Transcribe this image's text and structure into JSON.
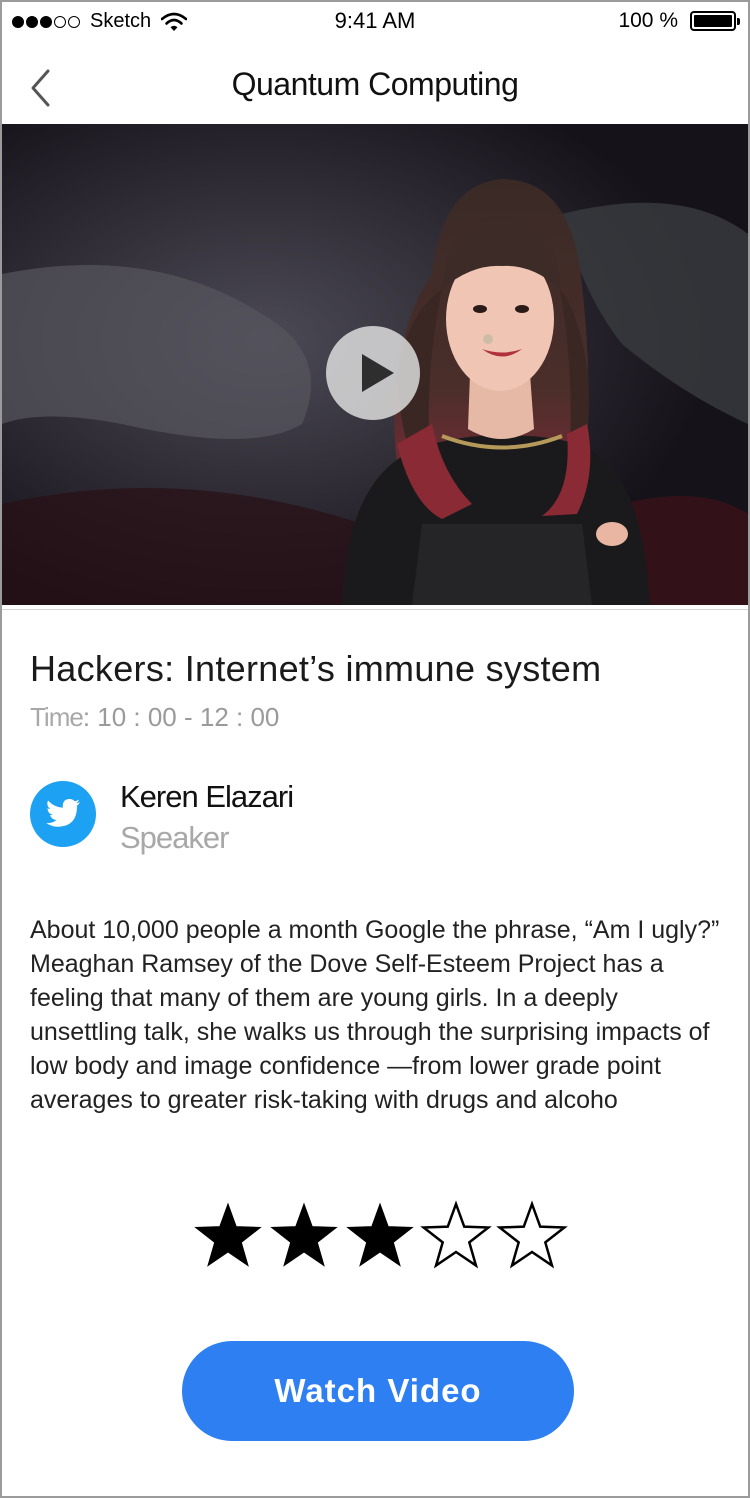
{
  "status_bar": {
    "carrier": "Sketch",
    "time": "9:41 AM",
    "battery_percent": "100 %"
  },
  "nav": {
    "title": "Quantum Computing",
    "back_icon": "chevron-left-icon"
  },
  "video": {
    "play_icon": "play-icon"
  },
  "talk": {
    "title": "Hackers: Internet’s immune system",
    "time_label": "Time",
    "time_value": ": 10 : 00 - 12 : 00"
  },
  "speaker": {
    "icon": "twitter-icon",
    "name": "Keren Elazari",
    "role": "Speaker"
  },
  "description": "About 10,000 people a month Google the phrase, “Am I ugly?” Meaghan Ramsey of the Dove Self-Esteem Project has a feeling that many of them are young girls. In a deeply unsettling talk, she walks us through the surprising impacts of low body and image confidence —from lower grade point averages to greater risk-taking with drugs and alcoho",
  "rating": {
    "value": 3,
    "max": 5
  },
  "actions": {
    "watch_label": "Watch Video"
  },
  "colors": {
    "accent": "#2e7ff1",
    "twitter": "#1da1f2",
    "muted_text": "#a8a8a8"
  }
}
